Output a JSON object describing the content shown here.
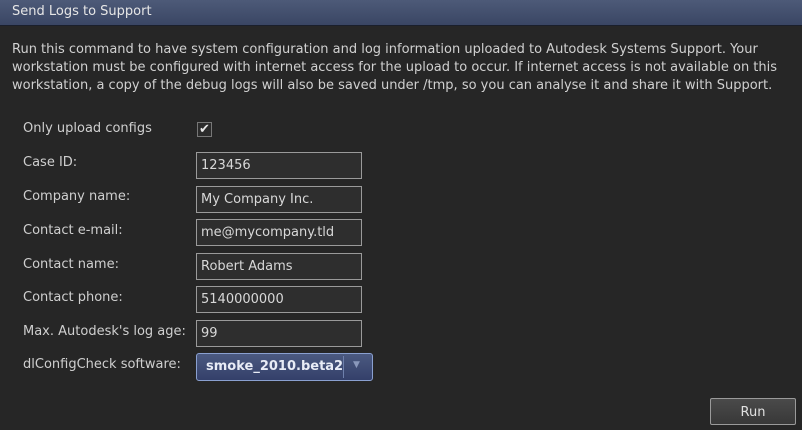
{
  "window": {
    "title": "Send Logs to Support"
  },
  "description": "Run this command to have system configuration and log information uploaded to Autodesk Systems Support. Your workstation must be configured with internet access for the upload to occur. If internet access is not available on this workstation, a copy of the debug logs will also be saved under /tmp, so you can analyse it and share it with Support.",
  "form": {
    "only_upload_configs": {
      "label": "Only upload configs",
      "checked": true,
      "check_glyph": "✔"
    },
    "case_id": {
      "label": "Case ID:",
      "value": "123456"
    },
    "company_name": {
      "label": "Company name:",
      "value": "My Company Inc."
    },
    "contact_email": {
      "label": "Contact e-mail:",
      "value": "me@mycompany.tld"
    },
    "contact_name": {
      "label": "Contact name:",
      "value": "Robert Adams"
    },
    "contact_phone": {
      "label": "Contact phone:",
      "value": "5140000000"
    },
    "max_log_age": {
      "label": "Max. Autodesk's log age:",
      "value": "99"
    },
    "dlconfigcheck": {
      "label": "dlConfigCheck software:",
      "selected": "smoke_2010.beta2"
    }
  },
  "buttons": {
    "run_label": "Run"
  }
}
